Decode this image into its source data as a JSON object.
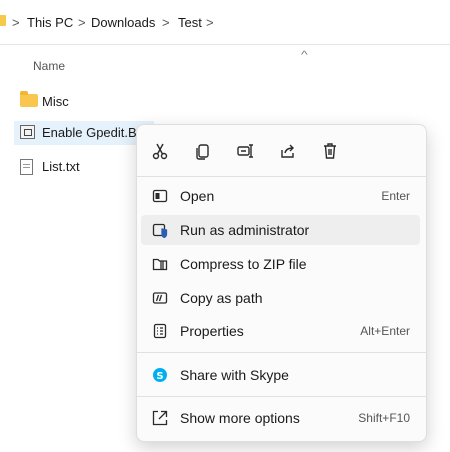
{
  "breadcrumb": {
    "items": [
      "This PC",
      "Downloads",
      "Test"
    ],
    "separator": ">"
  },
  "list": {
    "column_header": "Name",
    "files": [
      {
        "name": "Misc",
        "icon": "folder-icon"
      },
      {
        "name": "Enable Gpedit.BA",
        "icon": "batch-file-icon",
        "selected": true
      },
      {
        "name": "List.txt",
        "icon": "text-file-icon"
      }
    ]
  },
  "context_menu": {
    "quick_actions": [
      {
        "name": "cut",
        "icon": "scissors-icon"
      },
      {
        "name": "copy",
        "icon": "copy-icon"
      },
      {
        "name": "rename",
        "icon": "rename-icon"
      },
      {
        "name": "share",
        "icon": "share-icon"
      },
      {
        "name": "delete",
        "icon": "trash-icon"
      }
    ],
    "items": [
      {
        "label": "Open",
        "shortcut": "Enter",
        "icon": "open-icon"
      },
      {
        "label": "Run as administrator",
        "shortcut": "",
        "icon": "shield-admin-icon",
        "highlighted": true
      },
      {
        "label": "Compress to ZIP file",
        "shortcut": "",
        "icon": "zip-icon"
      },
      {
        "label": "Copy as path",
        "shortcut": "",
        "icon": "copy-path-icon"
      },
      {
        "label": "Properties",
        "shortcut": "Alt+Enter",
        "icon": "properties-icon"
      },
      {
        "label": "Share with Skype",
        "shortcut": "",
        "icon": "skype-icon"
      },
      {
        "label": "Show more options",
        "shortcut": "Shift+F10",
        "icon": "more-options-icon"
      }
    ]
  },
  "colors": {
    "folder": "#f9c74f",
    "selection": "#e5f1fb",
    "menu_bg": "#fbfbfb",
    "skype": "#00aff0",
    "shield_blue": "#2b5fb4"
  }
}
